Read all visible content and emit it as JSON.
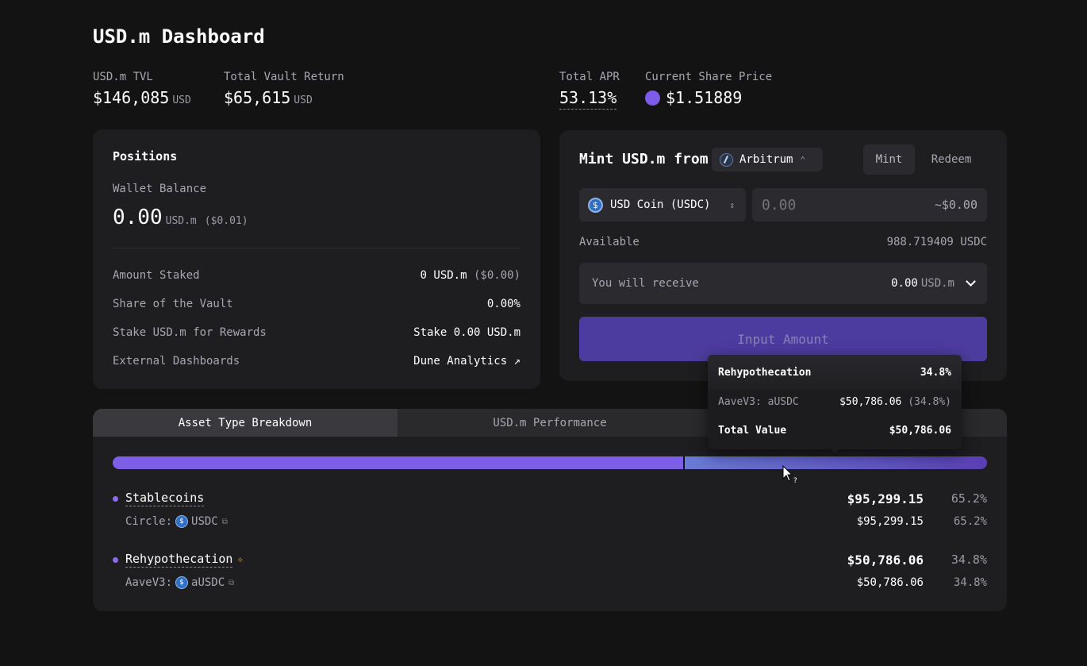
{
  "page_title": "USD.m Dashboard",
  "stats": {
    "tvl": {
      "label": "USD.m TVL",
      "value": "$146,085",
      "unit": "USD"
    },
    "vault_return": {
      "label": "Total Vault Return",
      "value": "$65,615",
      "unit": "USD"
    },
    "apr": {
      "label": "Total APR",
      "value": "53.13%"
    },
    "share_price": {
      "label": "Current Share Price",
      "value": "$1.51889",
      "dot_color": "#7c5ce8"
    }
  },
  "positions": {
    "title": "Positions",
    "wallet_label": "Wallet Balance",
    "wallet_value": "0.00",
    "wallet_unit": "USD.m",
    "wallet_usd": "($0.01)",
    "rows": [
      {
        "label": "Amount Staked",
        "value": "0 USD.m",
        "extra": "($0.00)"
      },
      {
        "label": "Share of the Vault",
        "value": "0.00%"
      },
      {
        "label": "Stake USD.m for Rewards",
        "value": "Stake 0.00 USD.m"
      },
      {
        "label": "External Dashboards",
        "value": "Dune Analytics ↗"
      }
    ]
  },
  "mint": {
    "title": "Mint USD.m from",
    "chain": "Arbitrum",
    "tab_mint": "Mint",
    "tab_redeem": "Redeem",
    "token": "USD Coin (USDC)",
    "token_icon": "$",
    "amount_placeholder": "0.00",
    "amount_usd": "~$0.00",
    "available_label": "Available",
    "available_value": "988.719409 USDC",
    "receive_label": "You will receive",
    "receive_value": "0.00",
    "receive_unit": "USD.m",
    "cta": "Input Amount"
  },
  "breakdown": {
    "tabs": [
      "Asset Type Breakdown",
      "USD.m Performance",
      ""
    ],
    "bar": [
      65.2,
      34.8
    ],
    "categories": [
      {
        "name": "Stablecoins",
        "amount": "$95,299.15",
        "pct": "65.2%",
        "sub": {
          "provider": "Circle:",
          "token": "USDC",
          "amount": "$95,299.15",
          "pct": "65.2%"
        }
      },
      {
        "name": "Rehypothecation",
        "amount": "$50,786.06",
        "pct": "34.8%",
        "sub": {
          "provider": "AaveV3:",
          "token": "aUSDC",
          "amount": "$50,786.06",
          "pct": "34.8%"
        }
      }
    ]
  },
  "tooltip": {
    "title": "Rehypothecation",
    "title_pct": "34.8%",
    "row_label": "AaveV3: aUSDC",
    "row_value": "$50,786.06",
    "row_pct": "(34.8%)",
    "total_label": "Total Value",
    "total_value": "$50,786.06"
  },
  "colors": {
    "accent": "#7d5ee8",
    "cta_bg": "#4d3c9f",
    "background": "#131313",
    "card": "#1e1e20"
  }
}
